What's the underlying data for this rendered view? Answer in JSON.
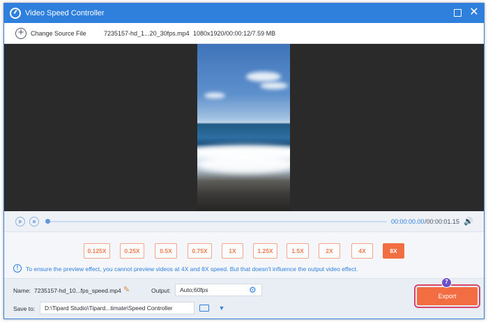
{
  "window": {
    "title": "Video Speed Controller",
    "icons": {
      "app": "speed-meter-icon",
      "maximize": "maximize-icon",
      "close": "close-icon"
    }
  },
  "source": {
    "change_label": "Change Source File",
    "file_name": "7235157-hd_1...20_30fps.mp4",
    "file_info": "1080x1920/00:00:12/7.59 MB"
  },
  "player": {
    "current_time": "00:00:00.00",
    "total_time": "/00:00:01.15",
    "progress": 0.0
  },
  "speeds": {
    "options": [
      "0.125X",
      "0.25X",
      "0.5X",
      "0.75X",
      "1X",
      "1.25X",
      "1.5X",
      "2X",
      "4X",
      "8X"
    ],
    "selected": "8X"
  },
  "tip": {
    "icon": "info-icon",
    "text": "To ensure the preview effect, you cannot preview videos at 4X and 8X speed. But that doesn't influence the output video effect."
  },
  "output": {
    "name_label": "Name:",
    "name_value": "7235157-hd_10...fps_speed.mp4",
    "output_label": "Output:",
    "output_value": "Auto;60fps",
    "save_label": "Save to:",
    "save_value": "D:\\Tipard Studio\\Tipard...timate\\Speed Controller",
    "export_label": "Export"
  },
  "annotation": {
    "step": "7"
  },
  "colors": {
    "accent": "#2f7fdc",
    "export": "#f26d42",
    "speed_border": "#f2a58a"
  }
}
